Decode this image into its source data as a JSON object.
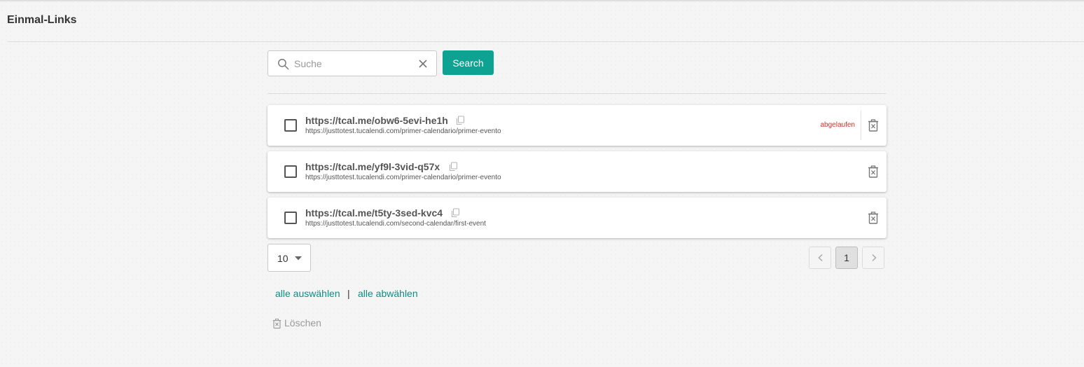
{
  "header": {
    "title": "Einmal-Links"
  },
  "search": {
    "placeholder": "Suche",
    "value": "",
    "button_label": "Search"
  },
  "links": [
    {
      "short_url": "https://tcal.me/obw6-5evi-he1h",
      "target_url": "https://justtotest.tucalendi.com/primer-calendario/primer-evento",
      "status": "abgelaufen",
      "checked": false
    },
    {
      "short_url": "https://tcal.me/yf9l-3vid-q57x",
      "target_url": "https://justtotest.tucalendi.com/primer-calendario/primer-evento",
      "status": "",
      "checked": false
    },
    {
      "short_url": "https://tcal.me/t5ty-3sed-kvc4",
      "target_url": "https://justtotest.tucalendi.com/second-calendar/first-event",
      "status": "",
      "checked": false
    }
  ],
  "pagination": {
    "page_size": "10",
    "current_page": "1"
  },
  "actions": {
    "select_all": "alle auswählen",
    "separator": "|",
    "deselect_all": "alle abwählen",
    "delete": "Löschen"
  },
  "colors": {
    "accent": "#0ea293",
    "link_text": "#0a8f82",
    "expired": "#c0392b"
  },
  "icons": {
    "search": "search-icon",
    "clear": "close-icon",
    "copy": "copy-icon",
    "delete": "trash-icon",
    "dropdown": "caret-down-icon",
    "prev": "chevron-left-icon",
    "next": "chevron-right-icon"
  }
}
